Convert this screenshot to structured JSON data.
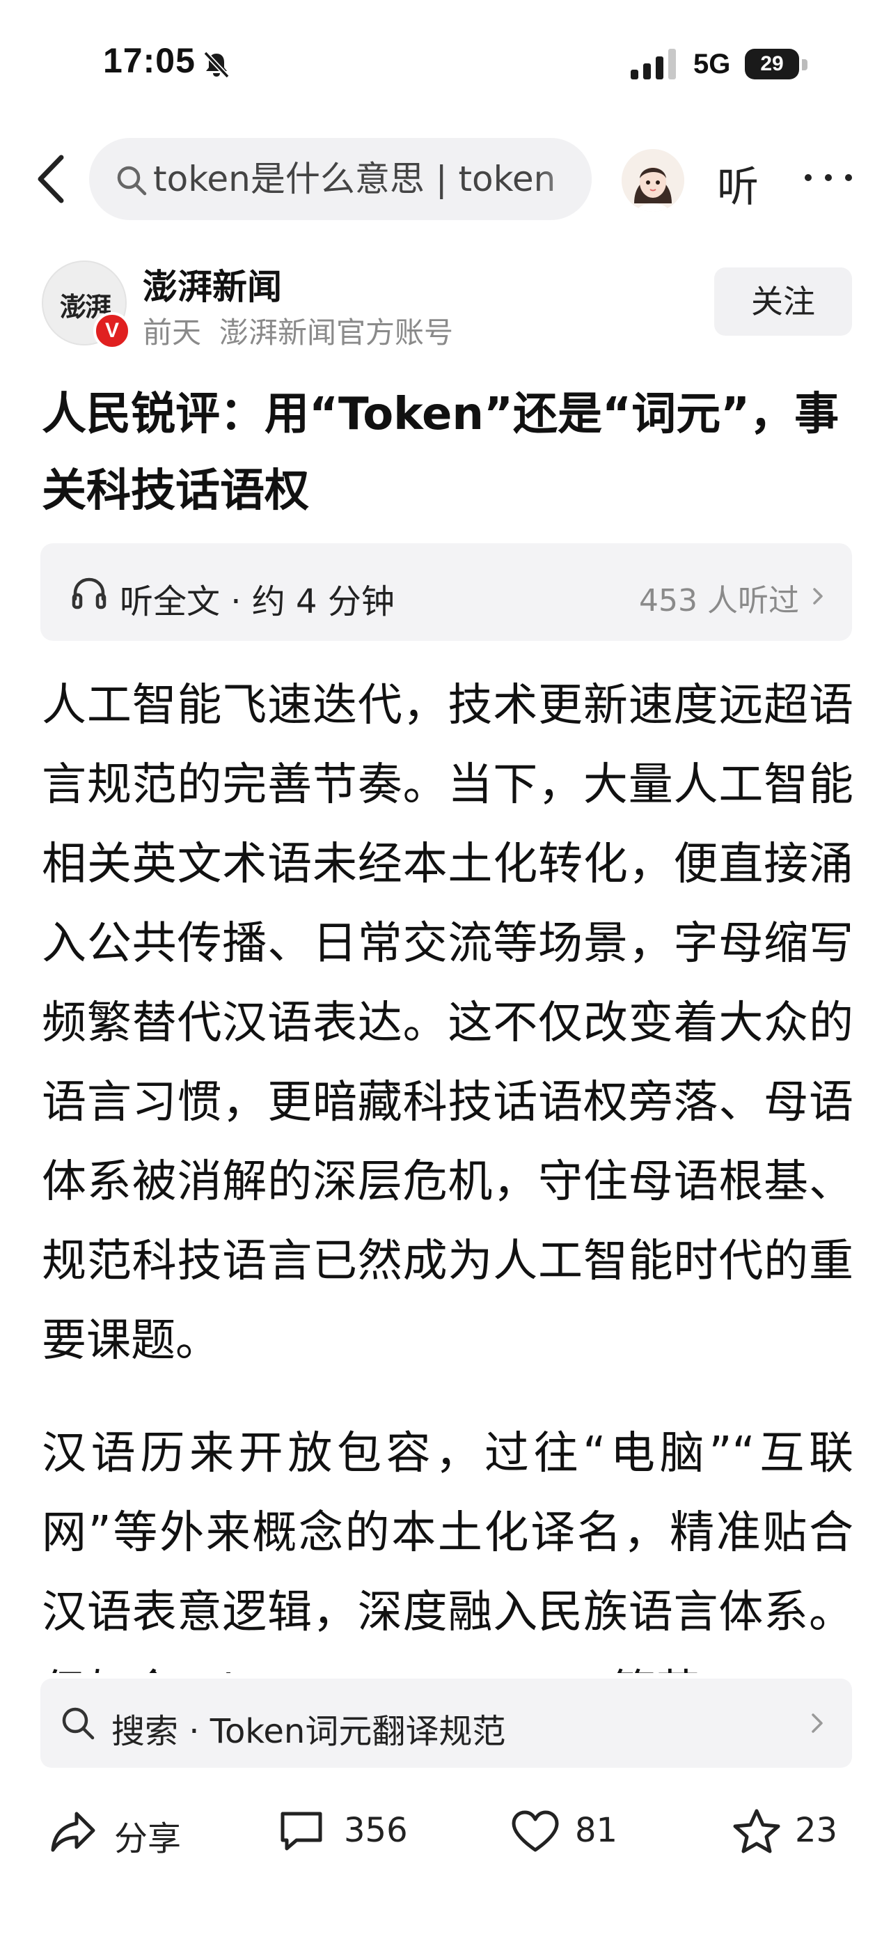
{
  "status_bar": {
    "time": "17:05",
    "network": "5G",
    "battery": "29"
  },
  "top_nav": {
    "search_query": "token是什么意思 | token",
    "listen_label": "听"
  },
  "author": {
    "name": "澎湃新闻",
    "avatar_logo": "澎湃",
    "verified_mark": "V",
    "time": "前天",
    "account_desc": "澎湃新闻官方账号",
    "follow_label": "关注"
  },
  "article": {
    "title": "人民锐评：用“Token”还是“词元”，事关科技话语权",
    "listen_label": "听全文 · 约 4 分钟",
    "listen_count": "453 人听过",
    "paragraphs": [
      "人工智能飞速迭代，技术更新速度远超语言规范的完善节奏。当下，大量人工智能相关英文术语未经本土化转化，便直接涌入公共传播、日常交流等场景，字母缩写频繁替代汉语表达。这不仅改变着大众的语言习惯，更暗藏科技话语权旁落、母语体系被消解的深层危机，守住母语根基、规范科技语言已然成为人工智能时代的重要课题。",
      "汉语历来开放包容，过往“电脑”“互联网”等外来概念的本土化译名，精准贴合汉语表意逻辑，深度融入民族语言体系。但如今Token、Agent、LLM等英"
    ]
  },
  "related_search": {
    "text": "搜索 · Token词元翻译规范"
  },
  "actions": {
    "share": "分享",
    "comments": "356",
    "likes": "81",
    "favorites": "23"
  }
}
